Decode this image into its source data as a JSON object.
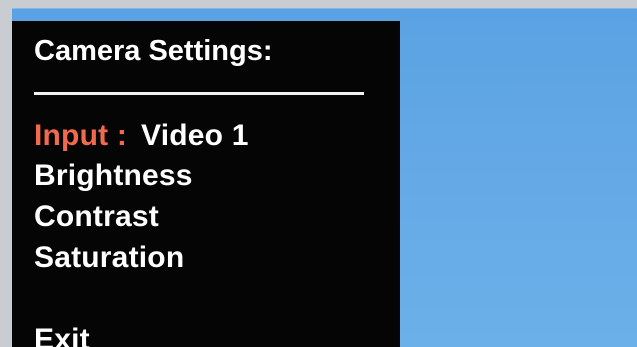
{
  "osd": {
    "title": "Camera Settings:",
    "input": {
      "label": "Input :",
      "value": "Video 1"
    },
    "items": [
      "Brightness",
      "Contrast",
      "Saturation"
    ],
    "exit_label": "Exit"
  },
  "colors": {
    "panel_background": "#050505",
    "text": "#ffffff",
    "selected_label": "#f26a4d",
    "screen_background": "#64a9e6"
  }
}
